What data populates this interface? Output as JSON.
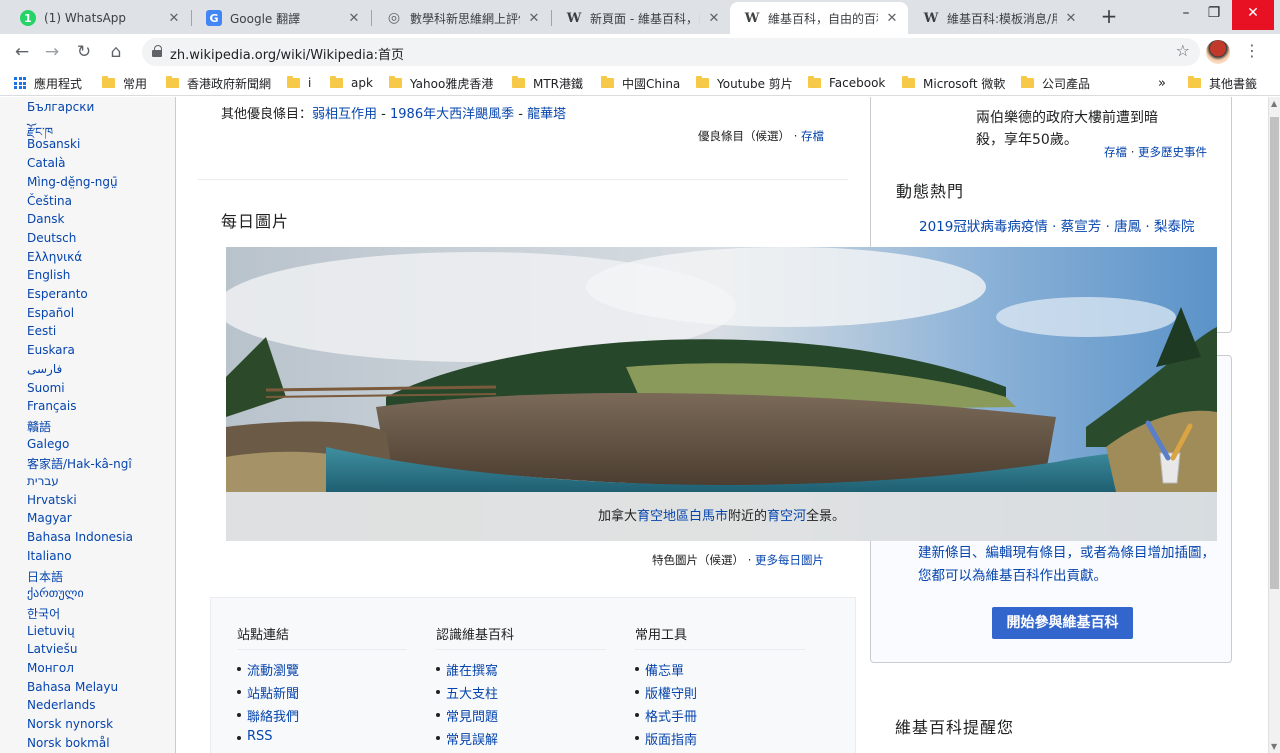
{
  "browser": {
    "tabs": [
      {
        "title": "(1) WhatsApp",
        "favicon": "whatsapp-icon",
        "fav_color": "#25d366",
        "fav_char": "1"
      },
      {
        "title": "Google 翻譯",
        "favicon": "google-translate-icon",
        "fav_color": "#4285f4",
        "fav_char": "G"
      },
      {
        "title": "數學科新思維網上評估",
        "favicon": "globe-icon",
        "fav_color": "#5f6368",
        "fav_char": "◎"
      },
      {
        "title": "新頁面 - 維基百科，自",
        "favicon": "wikipedia-icon",
        "fav_color": "#202124",
        "fav_char": "W"
      },
      {
        "title": "維基百科，自由的百科",
        "favicon": "wikipedia-icon",
        "fav_color": "#202124",
        "fav_char": "W"
      },
      {
        "title": "維基百科:模板消息/用",
        "favicon": "wikipedia-icon",
        "fav_color": "#202124",
        "fav_char": "W"
      }
    ],
    "tab_close": "✕",
    "new_tab": "+",
    "window_controls": {
      "minimize": "–",
      "restore": "❐",
      "close": "✕"
    },
    "url": "zh.wikipedia.org/wiki/Wikipedia:首页",
    "bookmarks": [
      {
        "label": "應用程式",
        "type": "apps"
      },
      {
        "label": "常用",
        "type": "folder"
      },
      {
        "label": "香港政府新聞網",
        "type": "folder"
      },
      {
        "label": "i",
        "type": "folder"
      },
      {
        "label": "apk",
        "type": "folder"
      },
      {
        "label": "Yahoo雅虎香港",
        "type": "folder"
      },
      {
        "label": "MTR港鐵",
        "type": "folder"
      },
      {
        "label": "中國China",
        "type": "folder"
      },
      {
        "label": "Youtube 剪片",
        "type": "folder"
      },
      {
        "label": "Facebook",
        "type": "folder"
      },
      {
        "label": "Microsoft 微軟",
        "type": "folder"
      },
      {
        "label": "公司產品",
        "type": "folder"
      },
      {
        "label": "»",
        "type": "more"
      },
      {
        "label": "其他書籤",
        "type": "folder"
      }
    ]
  },
  "languages": [
    "Български",
    "རྫོང་ཁ",
    "Bosanski",
    "Català",
    "Mìng-dĕ̤ng-ngṳ̄",
    "Čeština",
    "Dansk",
    "Deutsch",
    "Ελληνικά",
    "English",
    "Esperanto",
    "Español",
    "Eesti",
    "Euskara",
    "فارسی",
    "Suomi",
    "Français",
    "贛語",
    "Galego",
    "客家語/Hak-kâ-ngî",
    "עברית",
    "Hrvatski",
    "Magyar",
    "Bahasa Indonesia",
    "Italiano",
    "日本語",
    "ქართული",
    "한국어",
    "Lietuvių",
    "Latviešu",
    "Монгол",
    "Bahasa Melayu",
    "Nederlands",
    "Norsk nynorsk",
    "Norsk bokmål"
  ],
  "good_articles": {
    "prefix": "其他優良條目：",
    "items": [
      "弱相互作用",
      "1986年大西洋颶風季",
      "龍華塔"
    ],
    "sep": " - ",
    "links": {
      "candidates": "優良條目（候選）",
      "dot": "·",
      "archive": "存檔"
    }
  },
  "potd": {
    "title": "每日圖片",
    "caption_parts": [
      "加拿大",
      "育空地區",
      "白馬市",
      "附近的",
      "育空河",
      "全景。"
    ],
    "links": {
      "candidates": "特色圖片（候選）",
      "dot": "·",
      "more": "更多每日圖片"
    }
  },
  "footer": {
    "columns": [
      {
        "title": "站點連結",
        "items": [
          "流動瀏覽",
          "站點新聞",
          "聯絡我們",
          "RSS"
        ]
      },
      {
        "title": "認識維基百科",
        "items": [
          "誰在撰寫",
          "五大支柱",
          "常見問題",
          "常見誤解"
        ]
      },
      {
        "title": "常用工具",
        "items": [
          "備忘單",
          "版權守則",
          "格式手冊",
          "版面指南"
        ]
      }
    ]
  },
  "right": {
    "history_line1": "兩伯樂德的政府大樓前遭到暗",
    "history_line2": "殺，享年50歲。",
    "history_links": {
      "archive": "存檔",
      "dot": "·",
      "more": "更多歷史事件"
    },
    "trending_title": "動態熱門",
    "trending_line1": "2019冠狀病毒病疫情 · 蔡宣芳 · 唐鳳 · 梨泰院",
    "contrib_text": "建新條目、編輯現有條目，或者為條目增加插圖，您都可以為維基百科作出貢獻。",
    "contrib_button": "開始參與維基百科",
    "reminder_title": "維基百科提醒您"
  }
}
